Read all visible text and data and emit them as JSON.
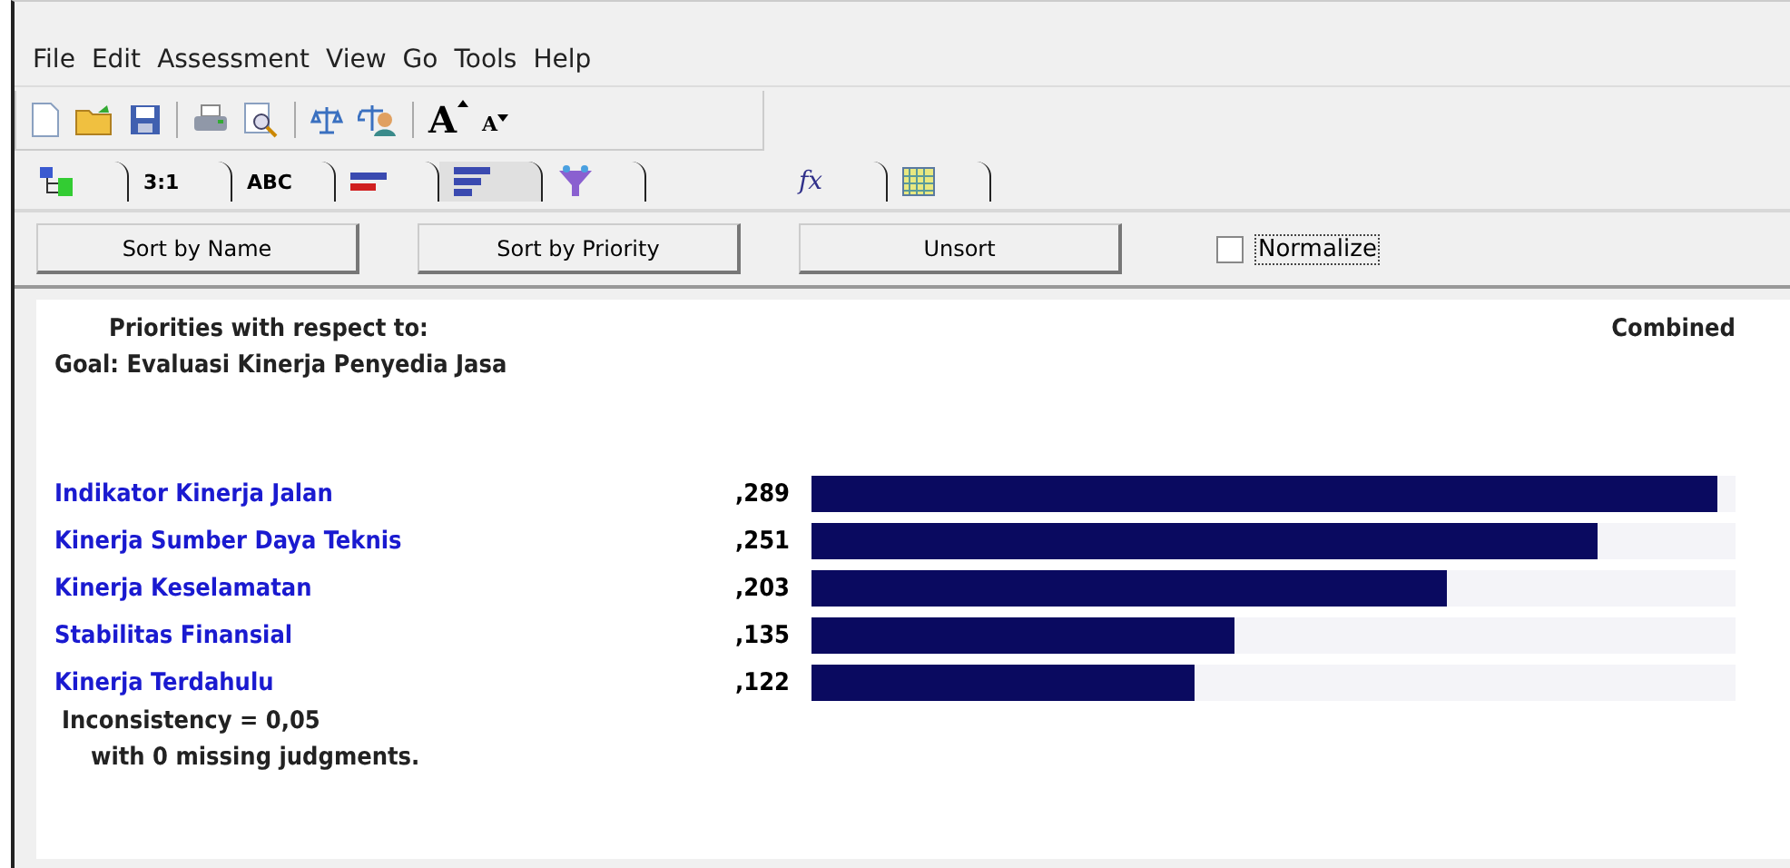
{
  "menu": [
    "File",
    "Edit",
    "Assessment",
    "View",
    "Go",
    "Tools",
    "Help"
  ],
  "font_buttons": [
    {
      "label": "A",
      "kind": "grow"
    },
    {
      "label": "A",
      "kind": "shrink"
    }
  ],
  "tabs": [
    {
      "kind": "tree",
      "selected": false
    },
    {
      "kind": "text",
      "label": "3:1",
      "selected": false
    },
    {
      "kind": "text",
      "label": "ABC",
      "selected": false
    },
    {
      "kind": "bars-red",
      "selected": false
    },
    {
      "kind": "bars",
      "selected": true
    },
    {
      "kind": "funnel",
      "selected": false
    }
  ],
  "tabs_right": [
    {
      "kind": "fx",
      "label": "fx",
      "selected": false
    },
    {
      "kind": "grid",
      "selected": false
    }
  ],
  "buttons": [
    "Sort by Name",
    "Sort by Priority",
    "Unsort"
  ],
  "normalize": {
    "label": "Normalize",
    "checked": false
  },
  "report": {
    "heading": "Priorities with respect to:",
    "combined": "Combined",
    "goal": "Goal: Evaluasi Kinerja Penyedia Jasa",
    "items": [
      {
        "name": "Indikator Kinerja Jalan",
        "value": ",289",
        "level": 0.98
      },
      {
        "name": "Kinerja Sumber Daya Teknis",
        "value": ",251",
        "level": 0.851
      },
      {
        "name": "Kinerja Keselamatan",
        "value": ",203",
        "level": 0.688
      },
      {
        "name": "Stabilitas Finansial",
        "value": ",135",
        "level": 0.458
      },
      {
        "name": "Kinerja Terdahulu",
        "value": ",122",
        "level": 0.414
      }
    ],
    "inconsistency": "Inconsistency = 0,05",
    "missing": "with 0  missing judgments."
  }
}
